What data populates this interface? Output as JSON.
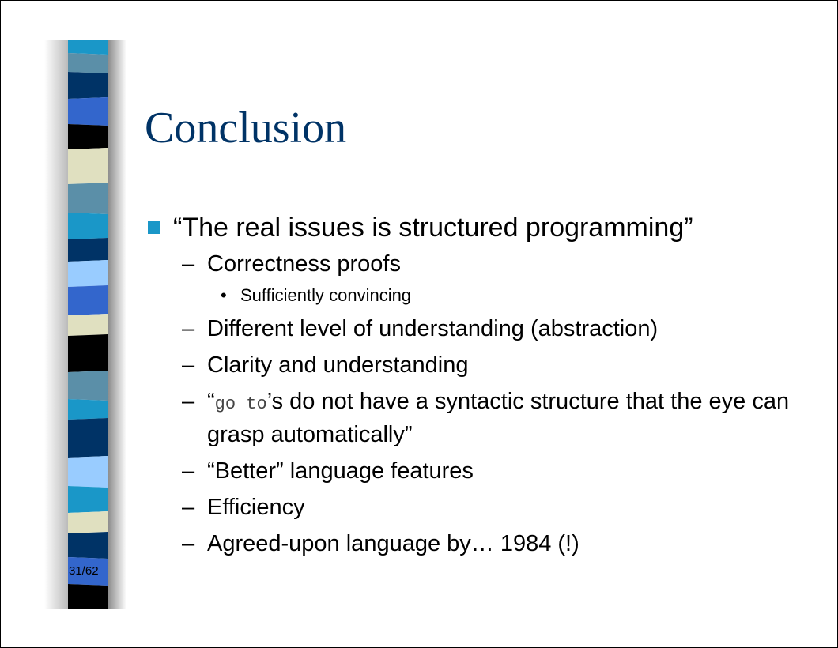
{
  "slide": {
    "title": "Conclusion",
    "page_number": "31/62",
    "colors": {
      "title": "#003366",
      "bullet": "#1a97c8",
      "bar_stripes": [
        "#1a97c8",
        "#5b8fa8",
        "#003366",
        "#3366cc",
        "#000000",
        "#e0e0c0",
        "#99ccff",
        "#0099cc"
      ]
    },
    "bullet": {
      "text": "“The real issues is structured programming”",
      "subitems": [
        {
          "text": "Correctness proofs",
          "subitems": [
            {
              "text": "Sufficiently convincing"
            }
          ]
        },
        {
          "text": "Different level of understanding (abstraction)"
        },
        {
          "text": "Clarity and understanding"
        },
        {
          "text_open": "“",
          "code": "go to",
          "text_rest": "’s do not have a syntactic structure that the eye can grasp automatically”"
        },
        {
          "text": "“Better” language features"
        },
        {
          "text": "Efficiency"
        },
        {
          "text": "Agreed-upon language by… 1984 (!)"
        }
      ]
    },
    "symbols": {
      "dash": "–",
      "dot": "•"
    }
  }
}
